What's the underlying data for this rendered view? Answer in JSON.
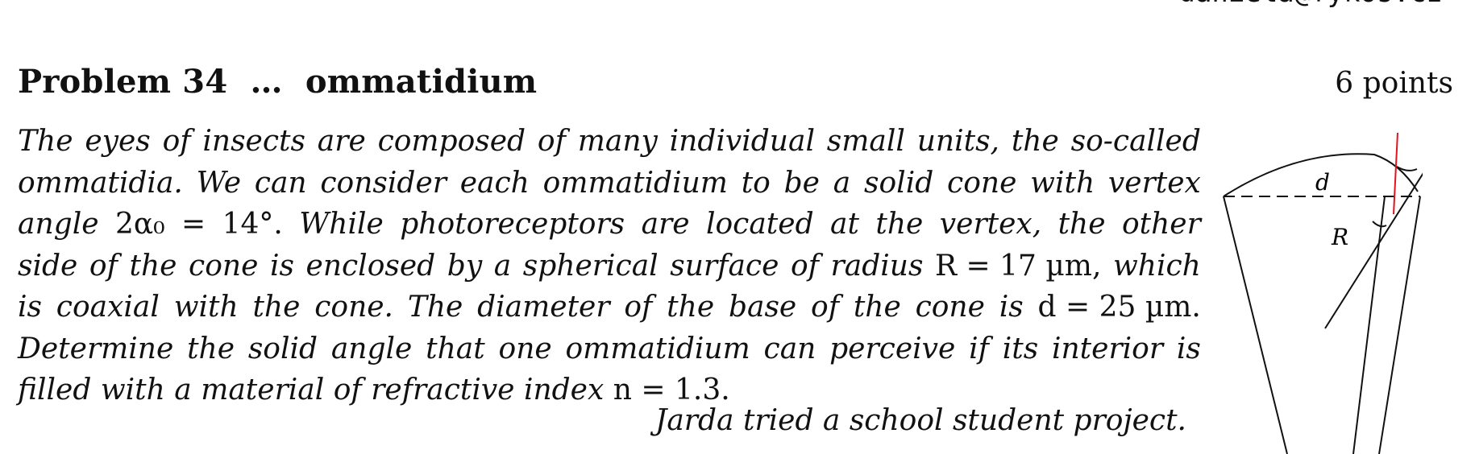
{
  "header": {
    "cut_text": "daniela@fykos.cz"
  },
  "problem": {
    "title": "Problem 34",
    "separator": "…",
    "name": "ommatidium",
    "points": "6 points",
    "lines": [
      [
        "The",
        "eyes",
        "of",
        "insects",
        "are",
        "composed",
        "of",
        "many",
        "individual",
        "small",
        "units,",
        "the",
        "so-called"
      ],
      [
        "ommatidia.",
        "We",
        "can",
        "consider",
        "each",
        "ommatidium",
        "to",
        "be",
        "a",
        "solid",
        "cone",
        "with",
        "vertex"
      ],
      [
        "angle",
        "2α₀",
        "=",
        "14°.",
        "While",
        "photoreceptors",
        "are",
        "located",
        "at",
        "the",
        "vertex,",
        "the",
        "other"
      ],
      [
        "side",
        "of",
        "the",
        "cone",
        "is",
        "enclosed",
        "by",
        "a",
        "spherical",
        "surface",
        "of",
        "radius",
        "R = 17 µm,",
        "which"
      ],
      [
        "is",
        "coaxial",
        "with",
        "the",
        "cone.",
        "The",
        "diameter",
        "of",
        "the",
        "base",
        "of",
        "the",
        "cone",
        "is",
        "d = 25 µm."
      ],
      [
        "Determine",
        "the",
        "solid",
        "angle",
        "that",
        "one",
        "ommatidium",
        "can",
        "perceive",
        "if",
        "its",
        "interior",
        "is"
      ],
      [
        "filled",
        "with",
        "a",
        "material",
        "of",
        "refractive",
        "index",
        "n = 1.3."
      ]
    ],
    "author": "Jarda tried a school student project."
  },
  "figure": {
    "label_d": "d",
    "label_R": "R",
    "ray_color": "#e0141e",
    "line_color": "#111111"
  }
}
